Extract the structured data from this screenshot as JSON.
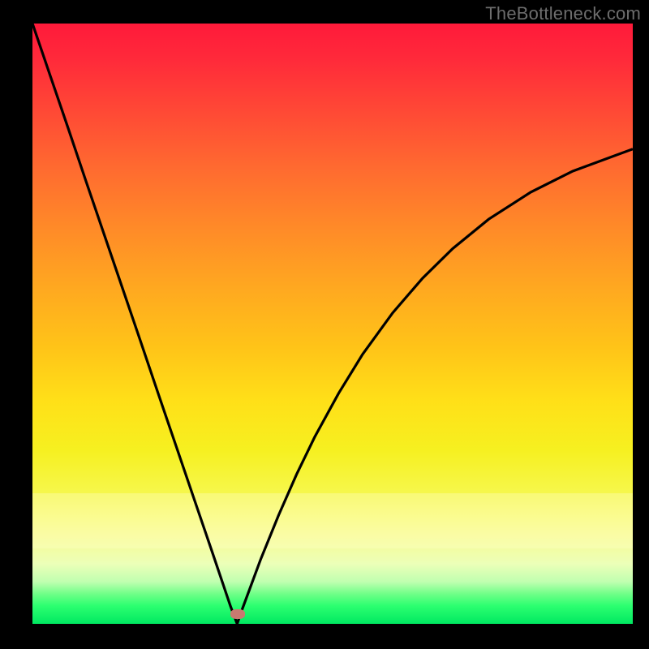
{
  "watermark": "TheBottleneck.com",
  "chart_data": {
    "type": "line",
    "x": [
      0.0,
      0.03,
      0.06,
      0.09,
      0.12,
      0.15,
      0.18,
      0.21,
      0.24,
      0.27,
      0.3,
      0.33,
      0.341,
      0.35,
      0.38,
      0.41,
      0.44,
      0.47,
      0.51,
      0.55,
      0.6,
      0.65,
      0.7,
      0.76,
      0.83,
      0.9,
      1.0
    ],
    "values": [
      1.0,
      0.912,
      0.824,
      0.735,
      0.647,
      0.559,
      0.471,
      0.382,
      0.294,
      0.206,
      0.118,
      0.029,
      0.0,
      0.026,
      0.107,
      0.181,
      0.249,
      0.311,
      0.384,
      0.449,
      0.518,
      0.576,
      0.625,
      0.674,
      0.719,
      0.754,
      0.791
    ],
    "title": "",
    "xlabel": "",
    "ylabel": "",
    "xlim": [
      0,
      1
    ],
    "ylim": [
      0,
      1
    ],
    "marker": {
      "x": 0.341,
      "y": 0.0
    }
  },
  "colors": {
    "frame_background": "#000000",
    "curve": "#000000",
    "marker": "#c97a70",
    "watermark": "#6d6d6d"
  }
}
